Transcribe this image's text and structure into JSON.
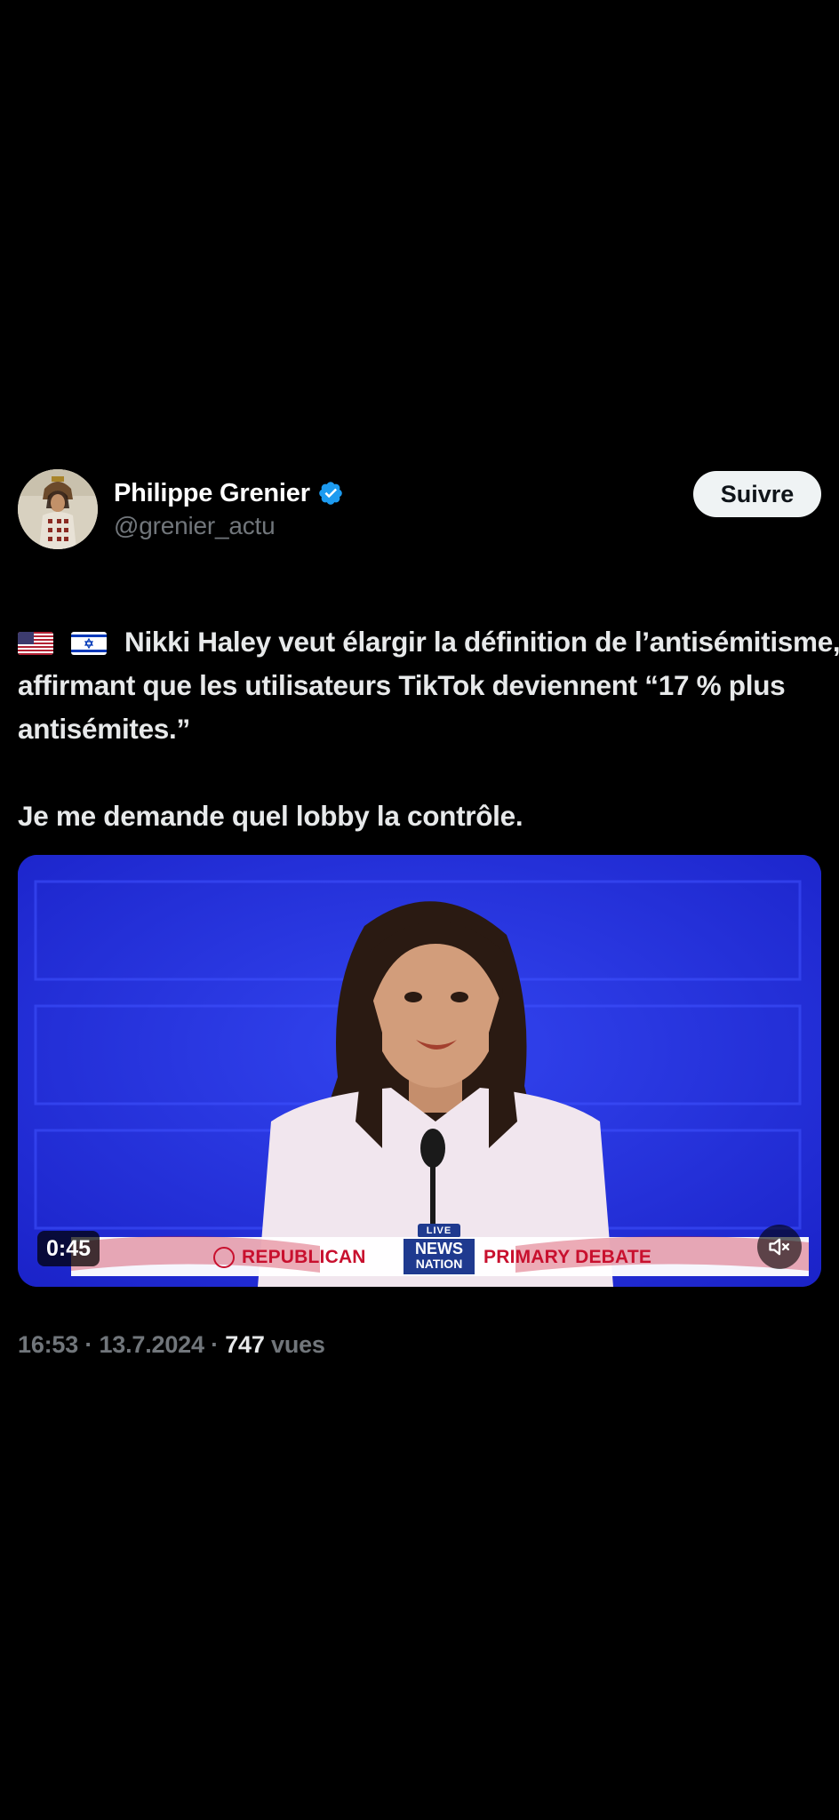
{
  "author": {
    "display_name": "Philippe Grenier",
    "handle": "@grenier_actu",
    "verified": true,
    "avatar_icon": "avatar-portrait-icon"
  },
  "follow_button": {
    "label": "Suivre"
  },
  "tweet": {
    "flags": [
      "us-flag-icon",
      "israel-flag-icon"
    ],
    "paragraph_1": "Nikki Haley veut élargir la définition de l’antisémitisme, affirmant que les utilisateurs TikTok deviennent “17 % plus antisémites.”",
    "paragraph_2": "Je me demande quel lobby la contrôle."
  },
  "video": {
    "duration": "0:45",
    "muted": true,
    "lower_third": {
      "left_text": "REPUBLICAN",
      "logo_line_1": "NEWS",
      "logo_line_2": "NATION",
      "live_tag": "LIVE",
      "right_text": "PRIMARY DEBATE"
    }
  },
  "meta": {
    "time": "16:53",
    "separator": "·",
    "date": "13.7.2024",
    "views_count": "747",
    "views_label": "vues"
  },
  "colors": {
    "background": "#000000",
    "text_primary": "#e7e9ea",
    "text_secondary": "#71767b",
    "verified_blue": "#1d9bf0",
    "follow_button_bg": "#eff3f4",
    "video_blue": "#2232e0",
    "lower_third_red": "#c8102e"
  }
}
